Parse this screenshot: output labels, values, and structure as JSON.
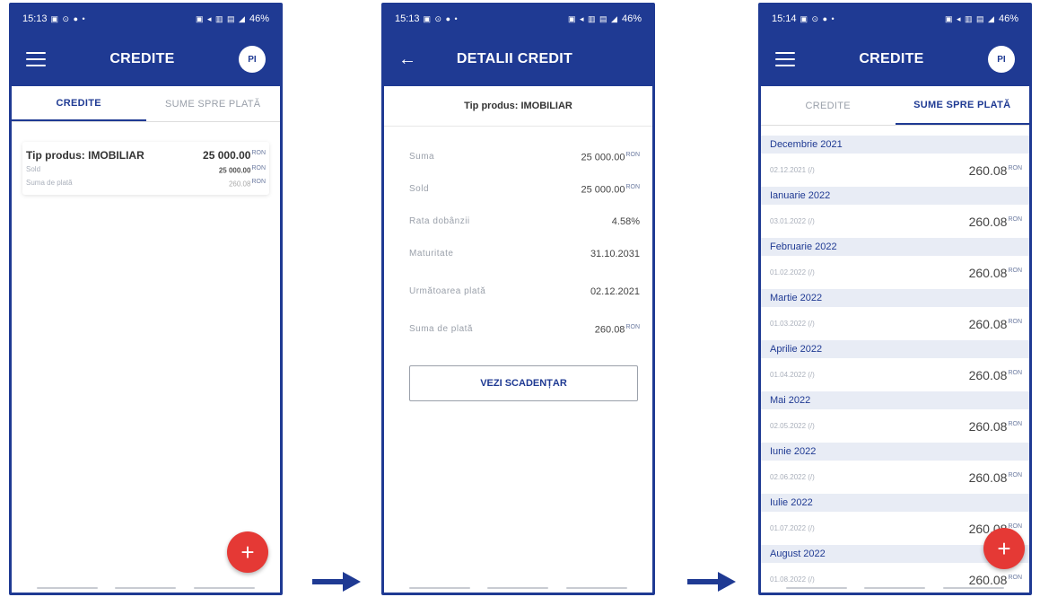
{
  "colors": {
    "brand": "#1f3a93",
    "fab": "#e53935",
    "month_bg": "#e8ecf5"
  },
  "status": {
    "p1": {
      "time": "15:13",
      "battery": "46%"
    },
    "p2": {
      "time": "15:13",
      "battery": "46%"
    },
    "p3": {
      "time": "15:14",
      "battery": "46%"
    }
  },
  "screen1": {
    "title": "CREDITE",
    "avatar": "PI",
    "tabs": [
      "CREDITE",
      "SUME SPRE PLATĂ"
    ],
    "card": {
      "title": "Tip produs: IMOBILIAR",
      "amount": "25 000.00",
      "currency": "RON",
      "sold_label": "Sold",
      "sold_value": "25 000.00",
      "suma_label": "Suma de plată",
      "suma_value": "260.08"
    },
    "fab": "+"
  },
  "screen2": {
    "title": "DETALII CREDIT",
    "heading": "Tip produs: IMOBILIAR",
    "rows": [
      {
        "label": "Suma",
        "value": "25 000.00",
        "currency": "RON"
      },
      {
        "label": "Sold",
        "value": "25 000.00",
        "currency": "RON"
      },
      {
        "label": "Rata dobânzii",
        "value": "4.58%"
      },
      {
        "label": "Maturitate",
        "value": "31.10.2031"
      },
      {
        "label": "Următoarea plată",
        "value": "02.12.2021"
      },
      {
        "label": "Suma de plată",
        "value": "260.08",
        "currency": "RON"
      }
    ],
    "button": "VEZI SCADENȚAR"
  },
  "screen3": {
    "title": "CREDITE",
    "avatar": "PI",
    "tabs": [
      "CREDITE",
      "SUME SPRE PLATĂ"
    ],
    "currency": "RON",
    "months": [
      {
        "month": "Decembrie 2021",
        "date": "02.12.2021 (/)",
        "amount": "260.08"
      },
      {
        "month": "Ianuarie 2022",
        "date": "03.01.2022 (/)",
        "amount": "260.08"
      },
      {
        "month": "Februarie 2022",
        "date": "01.02.2022 (/)",
        "amount": "260.08"
      },
      {
        "month": "Martie 2022",
        "date": "01.03.2022 (/)",
        "amount": "260.08"
      },
      {
        "month": "Aprilie 2022",
        "date": "01.04.2022 (/)",
        "amount": "260.08"
      },
      {
        "month": "Mai 2022",
        "date": "02.05.2022 (/)",
        "amount": "260.08"
      },
      {
        "month": "Iunie 2022",
        "date": "02.06.2022 (/)",
        "amount": "260.08"
      },
      {
        "month": "Iulie 2022",
        "date": "01.07.2022 (/)",
        "amount": "260.08"
      },
      {
        "month": "August 2022",
        "date": "01.08.2022 (/)",
        "amount": "260.08"
      }
    ],
    "fab": "+"
  }
}
